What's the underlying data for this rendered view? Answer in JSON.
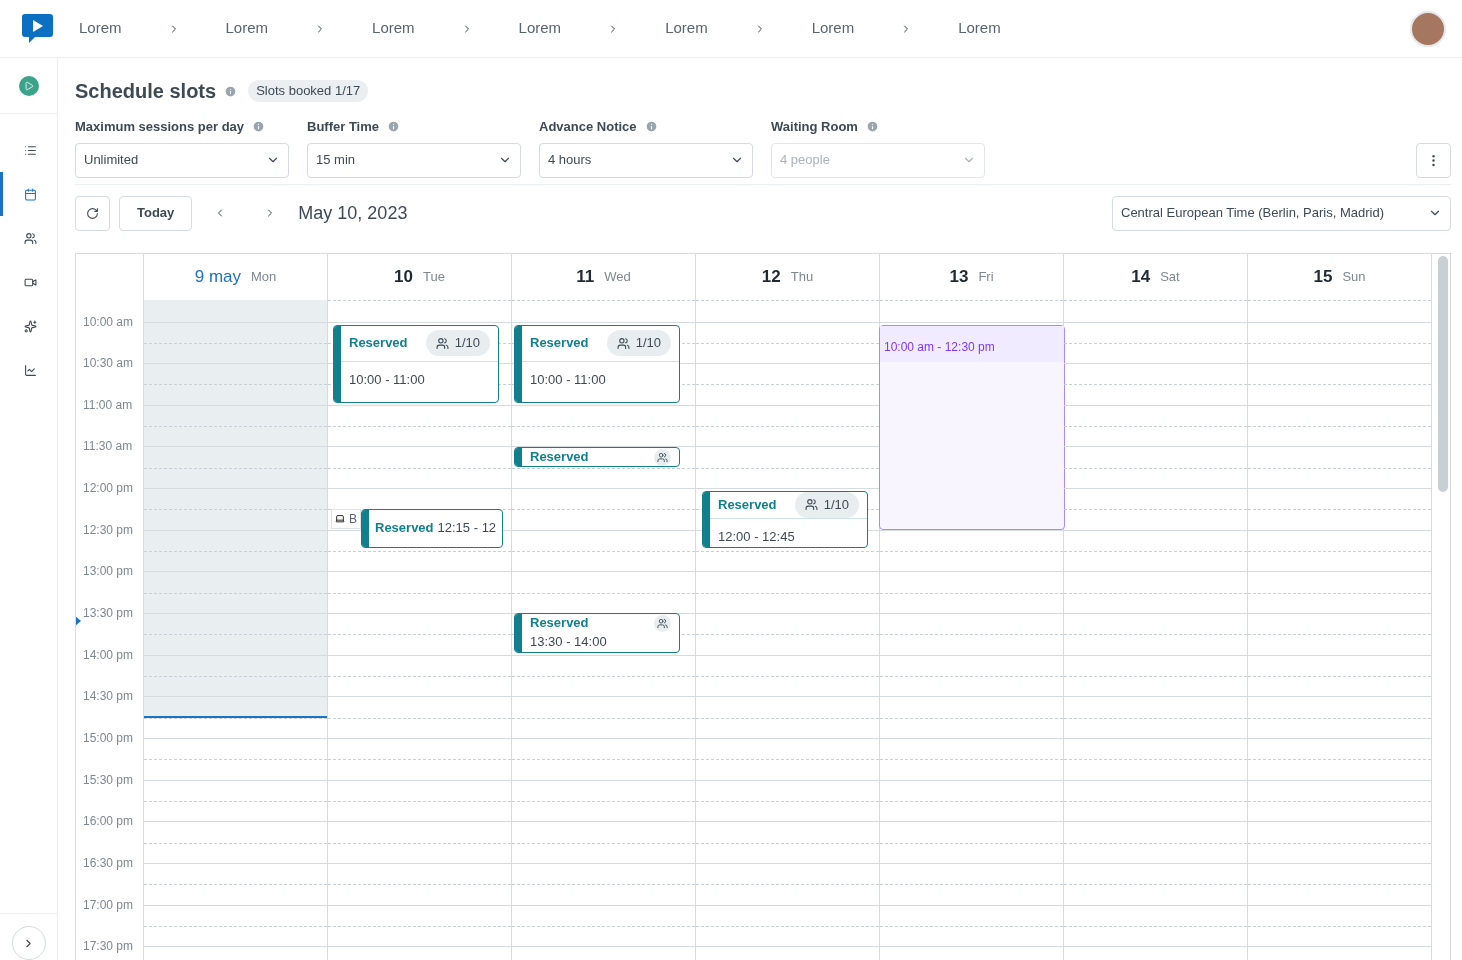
{
  "breadcrumbs": [
    "Lorem",
    "Lorem",
    "Lorem",
    "Lorem",
    "Lorem",
    "Lorem",
    "Lorem"
  ],
  "sidebar": {
    "items": [
      {
        "kind": "list",
        "selected": false
      },
      {
        "kind": "calendar",
        "selected": true
      },
      {
        "kind": "users",
        "selected": false
      },
      {
        "kind": "video",
        "selected": false
      },
      {
        "kind": "sparkles",
        "selected": false
      },
      {
        "kind": "chart",
        "selected": false
      }
    ]
  },
  "title": "Schedule slots",
  "badge": "Slots booked 1/17",
  "fields": [
    {
      "label": "Maximum sessions per day",
      "value": "Unlimited",
      "disabled": false
    },
    {
      "label": "Buffer Time",
      "value": "15 min",
      "disabled": false
    },
    {
      "label": "Advance Notice",
      "value": "4 hours",
      "disabled": false
    },
    {
      "label": "Waiting Room",
      "value": "4 people",
      "disabled": true
    }
  ],
  "toolbar": {
    "today": "Today",
    "date": "May 10, 2023",
    "timezone": "Central European Time (Berlin, Paris, Madrid)"
  },
  "times": [
    "10:00 am",
    "10:30 am",
    "11:00 am",
    "11:30 am",
    "12:00 pm",
    "12:30 pm",
    "13:00 pm",
    "13:30 pm",
    "14:00 pm",
    "14:30 pm",
    "15:00 pm",
    "15:30 pm",
    "16:00 pm",
    "16:30 pm",
    "17:00 pm",
    "17:30 pm"
  ],
  "days": [
    {
      "number": "9 may",
      "weekday": "Mon",
      "selected": true
    },
    {
      "number": "10",
      "weekday": "Tue",
      "selected": false,
      "events": [
        {
          "kind": "reserved",
          "label": "Reserved",
          "capacity": "1/10",
          "time": "10:00 - 11:00"
        },
        {
          "kind": "busy",
          "label": "B"
        },
        {
          "kind": "reserved",
          "label": "Reserved",
          "time": "12:15 - 12"
        }
      ]
    },
    {
      "number": "11",
      "weekday": "Wed",
      "selected": false,
      "events": [
        {
          "kind": "reserved",
          "label": "Reserved",
          "capacity": "1/10",
          "time": "10:00 - 11:00"
        },
        {
          "kind": "reserved",
          "label": "Reserved"
        },
        {
          "kind": "reserved",
          "label": "Reserved",
          "time": "13:30 - 14:00"
        }
      ]
    },
    {
      "number": "12",
      "weekday": "Thu",
      "selected": false,
      "events": [
        {
          "kind": "reserved",
          "label": "Reserved",
          "capacity": "1/10",
          "time": "12:00 - 12:45"
        }
      ]
    },
    {
      "number": "13",
      "weekday": "Fri",
      "selected": false,
      "events": [
        {
          "kind": "availability",
          "time": "10:00 am - 12:30 pm"
        }
      ]
    },
    {
      "number": "14",
      "weekday": "Sat",
      "selected": false
    },
    {
      "number": "15",
      "weekday": "Sun",
      "selected": false
    }
  ]
}
